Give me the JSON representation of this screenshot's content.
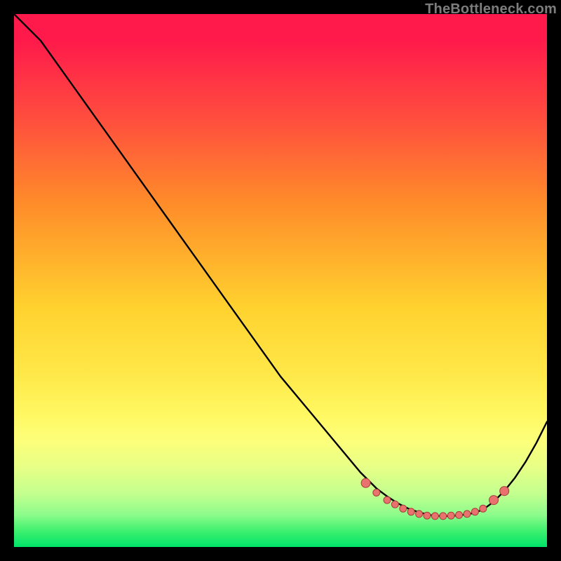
{
  "watermark": "TheBottleneck.com",
  "colors": {
    "background": "#000000",
    "gradient_top": "#ff1a4b",
    "gradient_bottom": "#00e36a",
    "curve_stroke": "#000000",
    "marker_fill": "#e9716e",
    "marker_stroke": "#a83d3b"
  },
  "chart_data": {
    "type": "line",
    "title": "",
    "xlabel": "",
    "ylabel": "",
    "xlim": [
      0,
      100
    ],
    "ylim": [
      0,
      100
    ],
    "grid": false,
    "series": [
      {
        "name": "curve",
        "x": [
          0,
          5,
          10,
          15,
          20,
          25,
          30,
          35,
          40,
          45,
          50,
          55,
          60,
          65,
          68,
          70,
          72,
          74,
          76,
          78,
          80,
          82,
          84,
          86,
          88,
          90,
          92,
          94,
          96,
          98,
          100
        ],
        "y": [
          100,
          95,
          88,
          81,
          74,
          67,
          60,
          53,
          46,
          39,
          32,
          26,
          20,
          14,
          11,
          9.5,
          8.2,
          7.2,
          6.5,
          6.0,
          5.8,
          5.8,
          6.0,
          6.3,
          7.0,
          8.5,
          10.5,
          13.0,
          16.0,
          19.5,
          23.5
        ]
      }
    ],
    "markers": {
      "name": "bottom-cluster",
      "x": [
        66,
        68,
        70,
        71.5,
        73,
        74.5,
        76,
        77.5,
        79,
        80.5,
        82,
        83.5,
        85,
        86.5,
        88,
        90,
        92
      ],
      "y": [
        12,
        10.2,
        8.8,
        8.0,
        7.2,
        6.6,
        6.2,
        5.9,
        5.8,
        5.8,
        5.9,
        6.0,
        6.2,
        6.6,
        7.2,
        8.8,
        10.5
      ]
    }
  }
}
